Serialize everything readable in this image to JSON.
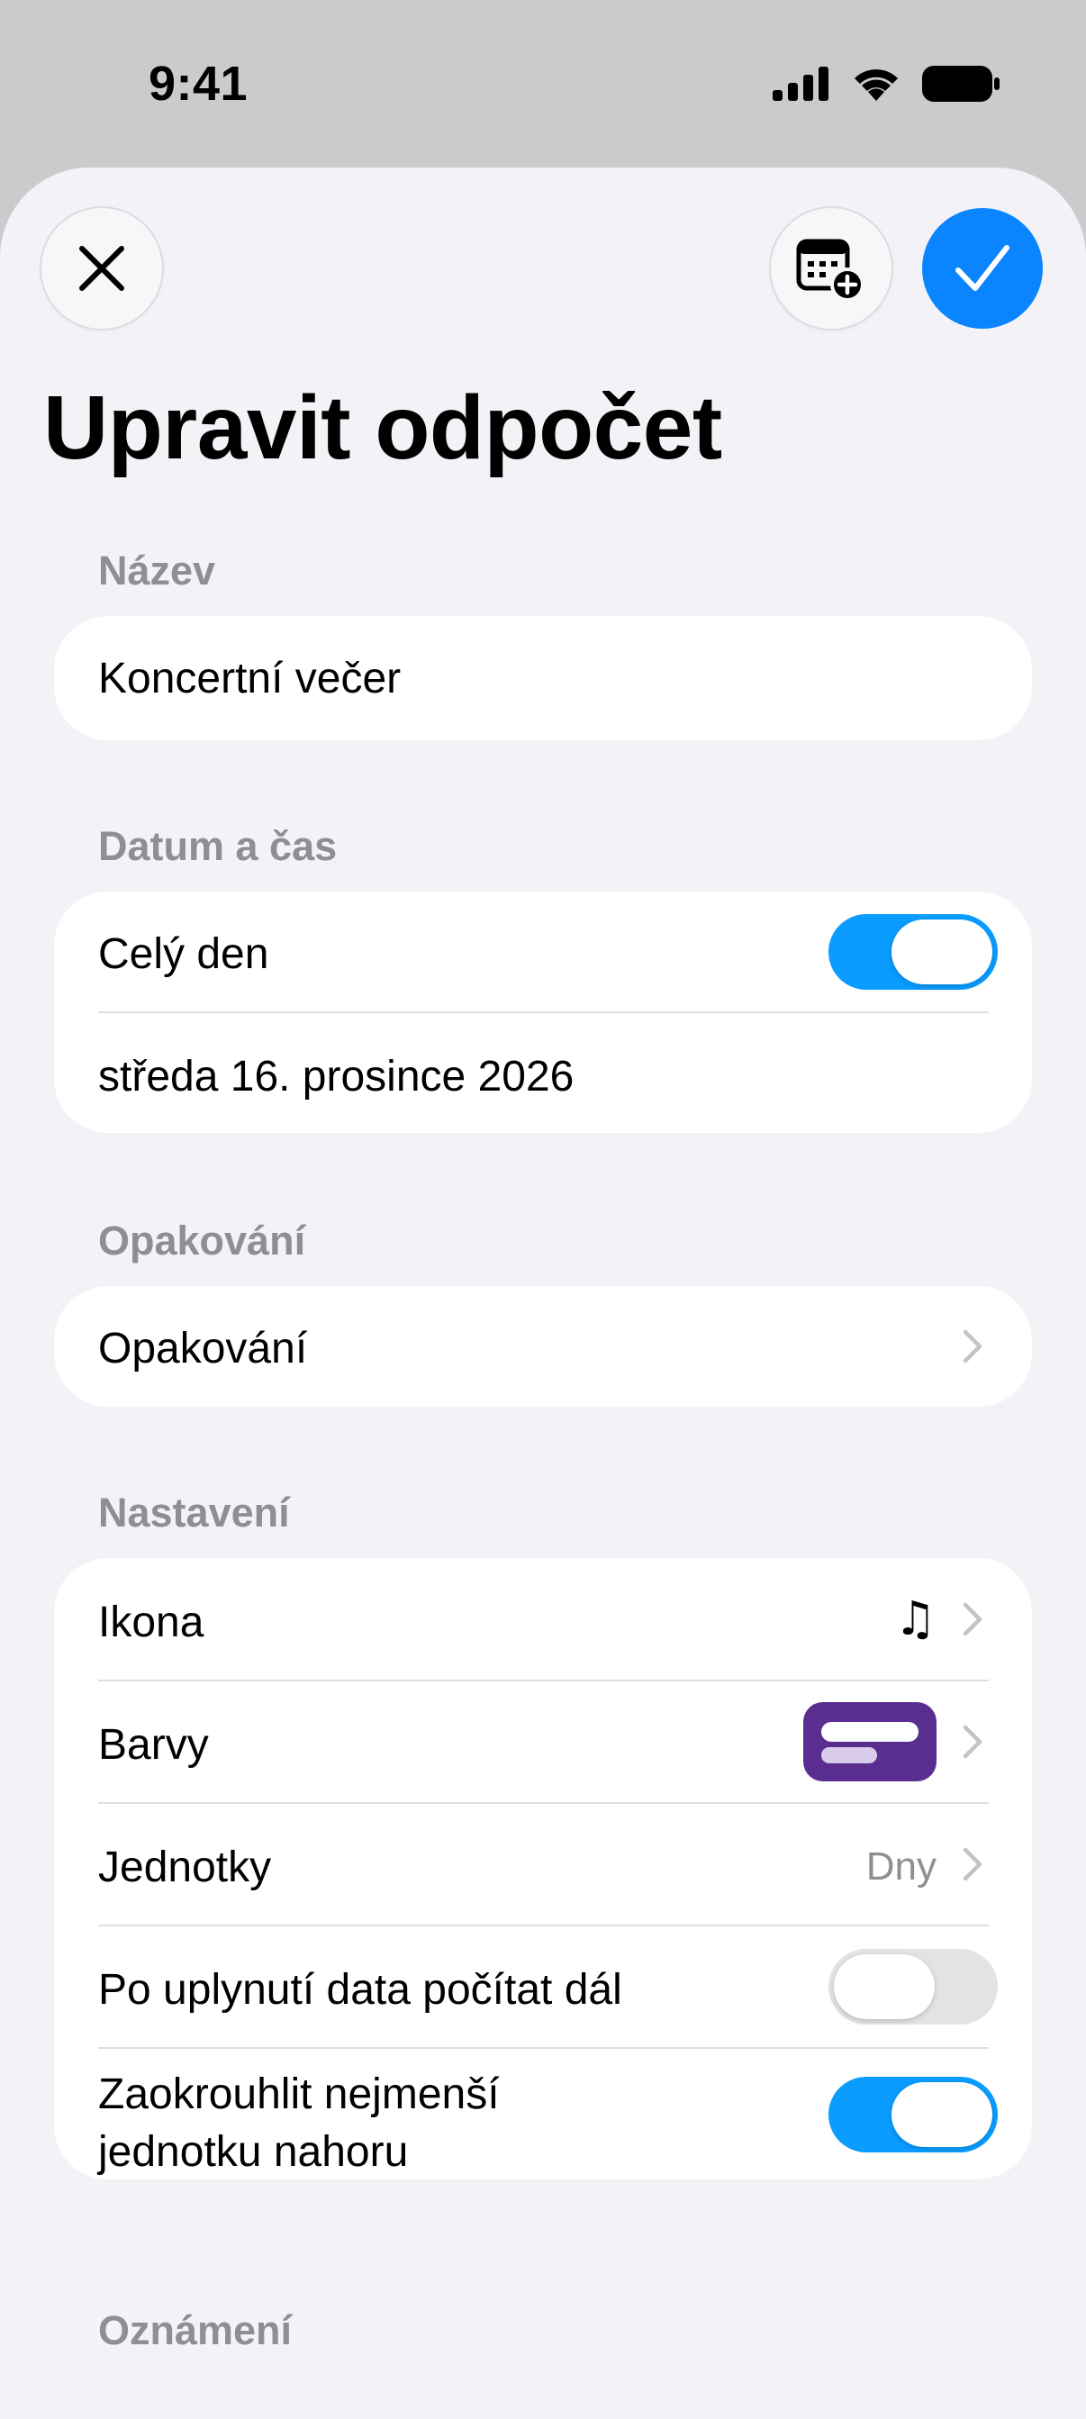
{
  "status": {
    "time": "9:41"
  },
  "title": "Upravit odpočet",
  "sections": {
    "name": {
      "header": "Název",
      "value": "Koncertní večer"
    },
    "datetime": {
      "header": "Datum a čas",
      "all_day_label": "Celý den",
      "all_day_on": true,
      "date_value": "středa 16. prosince 2026"
    },
    "repeat": {
      "header": "Opakování",
      "label": "Opakování"
    },
    "settings": {
      "header": "Nastavení",
      "icon_label": "Ikona",
      "icon_value": "♫",
      "colors_label": "Barvy",
      "units_label": "Jednotky",
      "units_value": "Dny",
      "count_past_label": "Po uplynutí data počítat dál",
      "count_past_on": false,
      "round_up_label_1": "Zaokrouhlit nejmenší",
      "round_up_label_2": "jednotku nahoru",
      "round_up_on": true
    },
    "notifications": {
      "header": "Oznámení"
    }
  },
  "colors": {
    "accent": "#0a84ff",
    "toggle_on": "#0a9cff",
    "swatch": "#5a2e91"
  }
}
